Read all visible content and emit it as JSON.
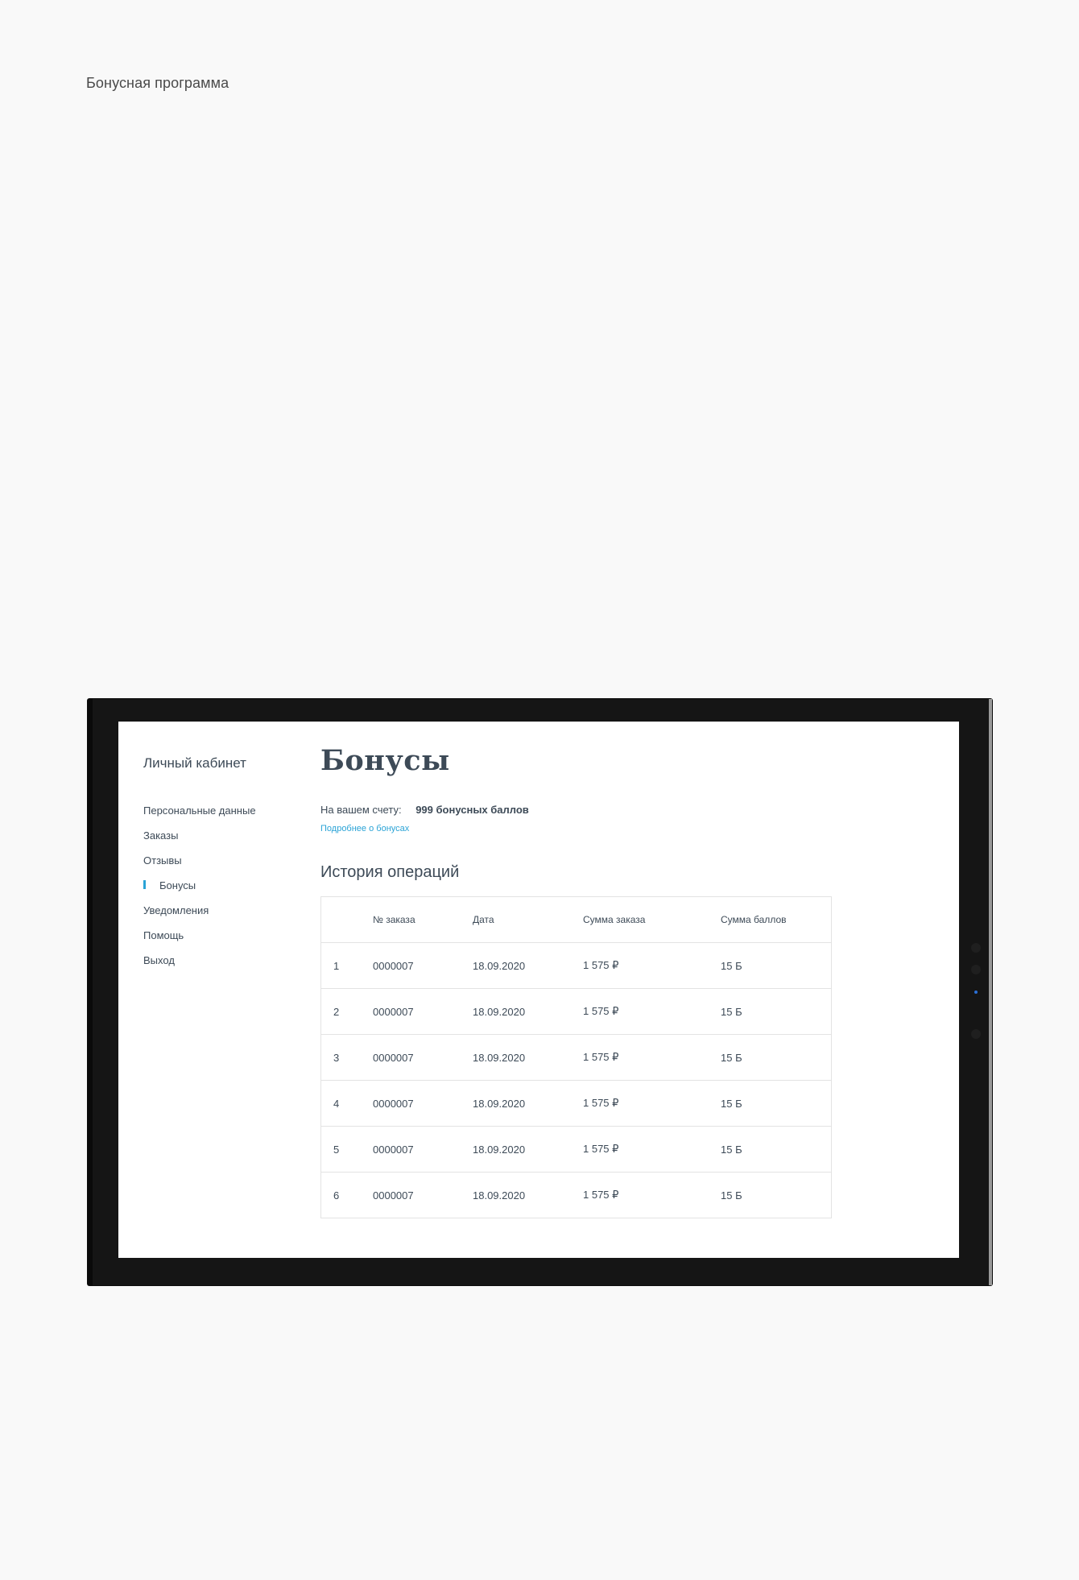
{
  "page": {
    "caption": "Бонусная программа"
  },
  "sidebar": {
    "title": "Личный кабинет",
    "items": [
      {
        "label": "Персональные данные",
        "active": false
      },
      {
        "label": "Заказы",
        "active": false
      },
      {
        "label": "Отзывы",
        "active": false
      },
      {
        "label": "Бонусы",
        "active": true
      },
      {
        "label": "Уведомления",
        "active": false
      },
      {
        "label": "Помощь",
        "active": false
      },
      {
        "label": "Выход",
        "active": false
      }
    ]
  },
  "main": {
    "title": "Бонусы",
    "balance_label": "На вашем счету:",
    "balance_value": "999 бонусных баллов",
    "bonus_link": "Подробнее о бонусах",
    "history_title": "История операций"
  },
  "table": {
    "headers": [
      "",
      "№ заказа",
      "Дата",
      "Сумма заказа",
      "Сумма баллов"
    ],
    "rows": [
      [
        "1",
        "0000007",
        "18.09.2020",
        "1 575 ₽",
        "15 Б"
      ],
      [
        "2",
        "0000007",
        "18.09.2020",
        "1 575 ₽",
        "15 Б"
      ],
      [
        "3",
        "0000007",
        "18.09.2020",
        "1 575 ₽",
        "15 Б"
      ],
      [
        "4",
        "0000007",
        "18.09.2020",
        "1 575 ₽",
        "15 Б"
      ],
      [
        "5",
        "0000007",
        "18.09.2020",
        "1 575 ₽",
        "15 Б"
      ],
      [
        "6",
        "0000007",
        "18.09.2020",
        "1 575 ₽",
        "15 Б"
      ]
    ]
  },
  "colors": {
    "accent": "#2aa3d6",
    "text": "#3d4a57",
    "frame": "#151515",
    "page_bg": "#f9f9f9"
  }
}
